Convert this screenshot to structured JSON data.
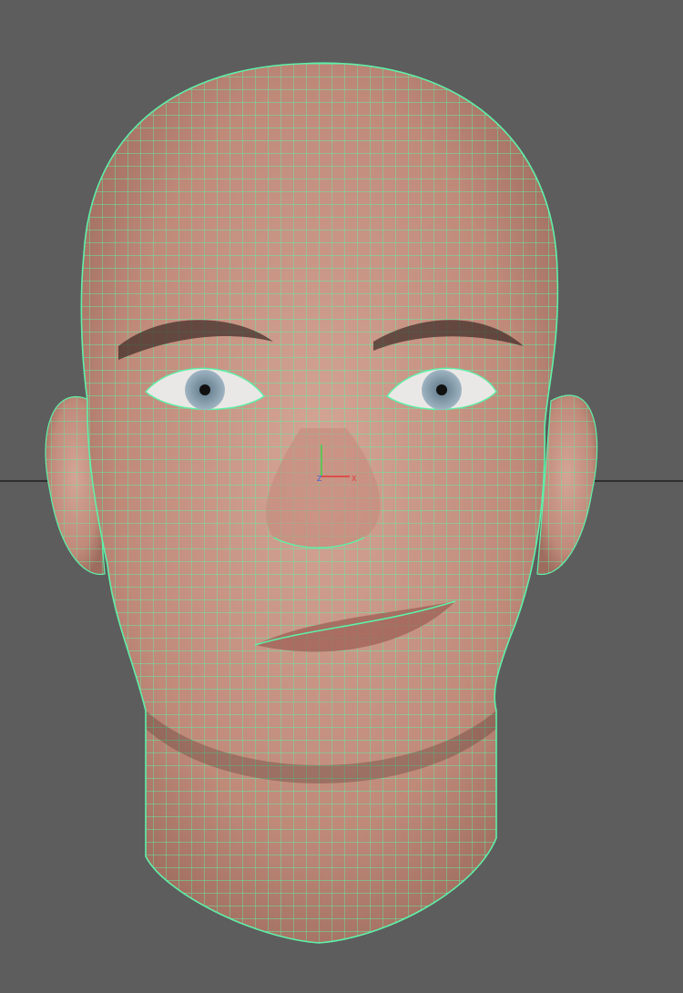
{
  "viewport": {
    "background": "#5d5d5d",
    "wireframe_color": "#5ff0a8",
    "skin_color": "#c89585",
    "horizon_color": "#2e2e2e"
  },
  "axis_gizmo": {
    "y_label": "",
    "z_label": "Z",
    "x_label": "X",
    "x_color": "#e03a3a",
    "y_color": "#3ad34a",
    "z_color": "#3a5ae0"
  },
  "model": {
    "name_icon": "head-mesh-icon",
    "eye_color": "#8fa6b5"
  }
}
